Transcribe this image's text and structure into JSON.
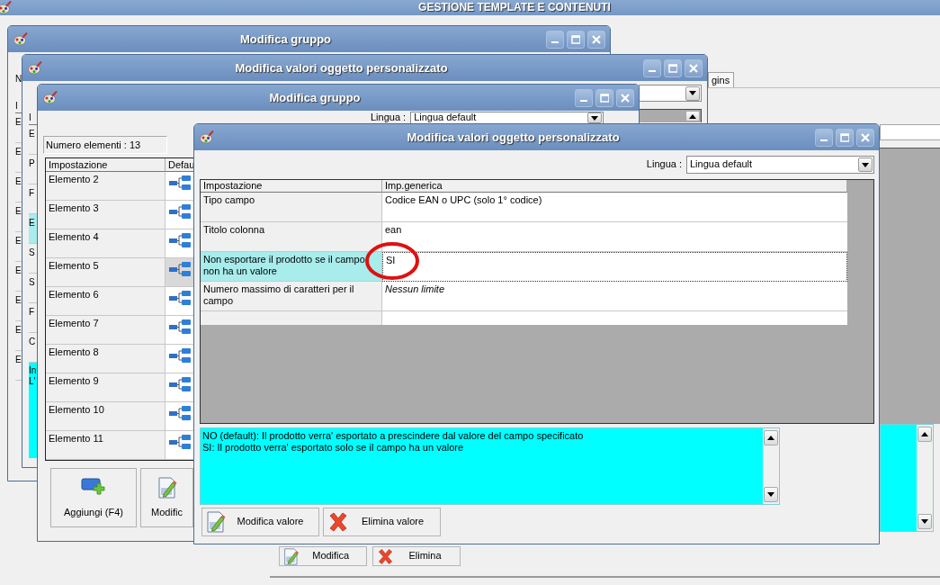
{
  "app": {
    "title": "GESTIONE TEMPLATE E CONTENUTI",
    "tab_label": "gins",
    "buttons": [
      {
        "label": "Modifica",
        "kind": "edit"
      },
      {
        "label": "Elimina",
        "kind": "delete"
      }
    ]
  },
  "windows": [
    {
      "kind": "group_back",
      "title": "Modifica gruppo",
      "tab_letter": "N",
      "strip_header": "I",
      "strip_cells": [
        {
          "text": "E",
          "selected": false
        },
        {
          "text": "E",
          "selected": false
        },
        {
          "text": "E",
          "selected": false
        },
        {
          "text": "E",
          "selected": false
        },
        {
          "text": "E",
          "selected": false
        },
        {
          "text": "E",
          "selected": false
        },
        {
          "text": "E",
          "selected": false
        },
        {
          "text": "E",
          "selected": false
        },
        {
          "text": "E",
          "selected": false
        }
      ]
    },
    {
      "kind": "values_back",
      "title": "Modifica valori oggetto personalizzato",
      "strip_header": "I",
      "strip_cells": [
        {
          "text": "E",
          "selected": false
        },
        {
          "text": "P",
          "selected": false
        },
        {
          "text": "F",
          "selected": false
        },
        {
          "text": "E",
          "selected": true
        },
        {
          "text": "S",
          "selected": false
        },
        {
          "text": "S",
          "selected": false
        },
        {
          "text": "F",
          "selected": false
        },
        {
          "text": "C",
          "selected": false
        }
      ],
      "note_lines": [
        "In",
        "L'"
      ]
    },
    {
      "kind": "group",
      "title": "Modifica gruppo",
      "language_label": "Lingua :",
      "language": "Lingua default",
      "count": "Numero elementi : 13",
      "columns": [
        "Impostazione",
        "Defau"
      ],
      "rows": [
        {
          "label": "Elemento 2",
          "selected": false
        },
        {
          "label": "Elemento 3",
          "selected": false
        },
        {
          "label": "Elemento 4",
          "selected": false
        },
        {
          "label": "Elemento 5",
          "selected": true
        },
        {
          "label": "Elemento 6",
          "selected": false
        },
        {
          "label": "Elemento 7",
          "selected": false
        },
        {
          "label": "Elemento 8",
          "selected": false
        },
        {
          "label": "Elemento 9",
          "selected": false
        },
        {
          "label": "Elemento 10",
          "selected": false
        },
        {
          "label": "Elemento 11",
          "selected": false
        }
      ],
      "buttons": [
        {
          "label": "Aggiungi (F4)",
          "kind": "add"
        },
        {
          "label": "Modific",
          "kind": "edit"
        }
      ]
    },
    {
      "kind": "values",
      "title": "Modifica valori oggetto personalizzato",
      "language_label": "Lingua :",
      "language": "Lingua default",
      "columns": [
        "Impostazione",
        "Imp.generica"
      ],
      "rows": [
        {
          "setting": "Tipo campo",
          "value": "Codice EAN o UPC (solo 1° codice)",
          "selected": false,
          "italic": false
        },
        {
          "setting": "Titolo colonna",
          "value": "ean",
          "selected": false,
          "italic": false
        },
        {
          "setting": "Non esportare il prodotto se il campo non ha un valore",
          "value": "SI",
          "selected": true,
          "italic": false
        },
        {
          "setting": "Numero massimo di caratteri per il campo",
          "value": "Nessun limite",
          "selected": false,
          "italic": true
        }
      ],
      "description": [
        "NO (default): Il prodotto verra' esportato a prescindere dal valore del campo specificato",
        "SI: Il prodotto verra' esportato solo se il campo ha un valore"
      ],
      "buttons": [
        {
          "label": "Modifica valore",
          "kind": "edit"
        },
        {
          "label": "Elimina valore",
          "kind": "delete"
        }
      ]
    }
  ]
}
